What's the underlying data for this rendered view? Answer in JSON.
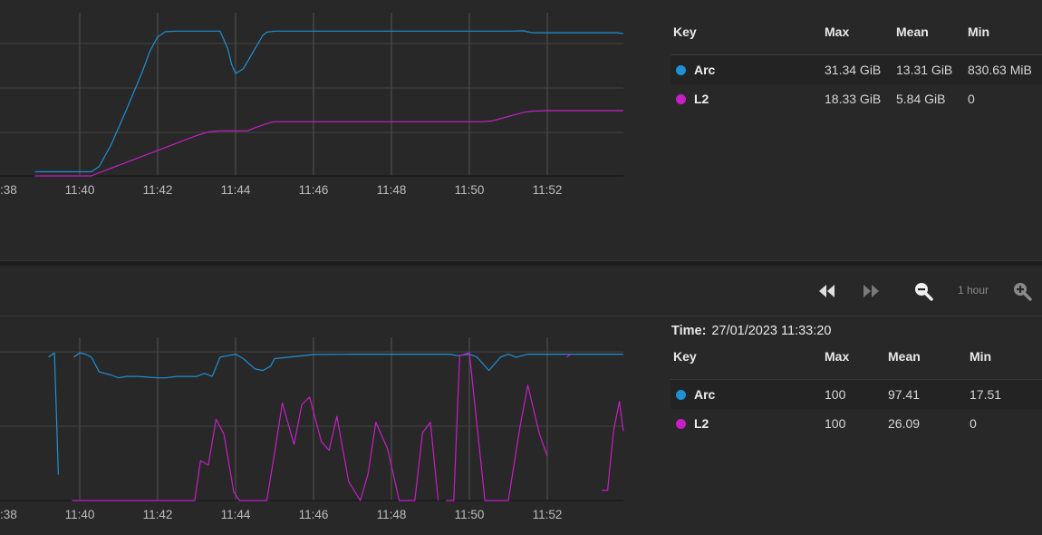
{
  "chart1": {
    "legend": {
      "headers": {
        "key": "Key",
        "max": "Max",
        "mean": "Mean",
        "min": "Min"
      },
      "rows": [
        {
          "name": "Arc",
          "max": "31.34 GiB",
          "mean": "13.31 GiB",
          "min": "830.63 MiB",
          "color": "#1e90d6"
        },
        {
          "name": "L2",
          "max": "18.33 GiB",
          "mean": "5.84 GiB",
          "min": "0",
          "color": "#c71ec7"
        }
      ]
    }
  },
  "chart2": {
    "time_label": "Time:",
    "time_value": "27/01/2023 11:33:20",
    "legend": {
      "headers": {
        "key": "Key",
        "max": "Max",
        "mean": "Mean",
        "min": "Min"
      },
      "rows": [
        {
          "name": "Arc",
          "max": "100",
          "mean": "97.41",
          "min": "17.51",
          "color": "#1e90d6"
        },
        {
          "name": "L2",
          "max": "100",
          "mean": "26.09",
          "min": "0",
          "color": "#c71ec7"
        }
      ]
    }
  },
  "toolbar": {
    "rewind_icon": "rewind-icon",
    "forward_icon": "fast-forward-icon",
    "zoom_out_icon": "zoom-out-icon",
    "zoom_in_icon": "zoom-in-icon",
    "range_label": "1 hour"
  },
  "chart_data": [
    {
      "type": "line",
      "x_ticks": [
        ":38",
        "11:40",
        "11:42",
        "11:44",
        "11:46",
        "11:48",
        "11:50",
        "11:52"
      ],
      "series": [
        {
          "name": "Arc",
          "color": "#1e90d6",
          "x": [
            38.85,
            39.0,
            39.5,
            40.0,
            40.3,
            40.5,
            40.8,
            41.2,
            41.6,
            41.8,
            42.0,
            42.2,
            42.5,
            43.0,
            43.4,
            43.6,
            43.8,
            43.9,
            44.0,
            44.2,
            44.5,
            44.7,
            44.8,
            45.0,
            46.0,
            47.0,
            48.0,
            49.0,
            50.0,
            51.0,
            51.4,
            51.6,
            52.0,
            53.0,
            53.8,
            53.95
          ],
          "y": [
            0.77,
            0.78,
            0.78,
            0.78,
            0.79,
            1.8,
            5.8,
            12.5,
            19.5,
            23.5,
            26.2,
            27.2,
            27.3,
            27.3,
            27.3,
            27.3,
            24.0,
            21.0,
            19.3,
            20.2,
            24.0,
            26.5,
            27.1,
            27.3,
            27.3,
            27.3,
            27.3,
            27.3,
            27.3,
            27.3,
            27.35,
            27.0,
            27.0,
            27.0,
            27.0,
            26.8
          ]
        },
        {
          "name": "L2",
          "color": "#c71ec7",
          "x": [
            38.85,
            39.5,
            40.0,
            40.3,
            40.5,
            41.0,
            41.5,
            42.0,
            42.5,
            43.0,
            43.3,
            43.6,
            44.0,
            44.3,
            44.5,
            44.9,
            45.0,
            46.0,
            47.0,
            48.0,
            49.0,
            50.0,
            50.3,
            50.6,
            51.0,
            51.4,
            51.6,
            52.0,
            53.0,
            53.95
          ],
          "y": [
            0.0,
            0.0,
            0.0,
            0.0,
            0.6,
            2.0,
            3.4,
            4.8,
            6.2,
            7.6,
            8.3,
            8.5,
            8.5,
            8.5,
            9.1,
            10.1,
            10.2,
            10.2,
            10.2,
            10.2,
            10.2,
            10.2,
            10.2,
            10.4,
            11.2,
            12.0,
            12.2,
            12.3,
            12.3,
            12.3
          ]
        }
      ]
    },
    {
      "type": "line",
      "x_ticks": [
        ":38",
        "11:40",
        "11:42",
        "11:44",
        "11:46",
        "11:48",
        "11:50",
        "11:52"
      ],
      "ylim": [
        0,
        100
      ],
      "series": [
        {
          "name": "Arc",
          "color": "#1e90d6",
          "segments": [
            {
              "x": [
                39.2,
                39.35
              ],
              "y": [
                97,
                100
              ]
            },
            {
              "x": [
                39.35,
                39.45
              ],
              "y": [
                100,
                17.5
              ]
            },
            {
              "x": [
                39.85,
                40.0,
                40.15,
                40.3,
                40.5,
                40.8,
                41.0,
                41.2,
                41.5,
                42.0,
                42.2,
                42.5,
                43.0,
                43.2,
                43.4,
                43.6,
                43.8,
                44.0,
                44.2,
                44.5,
                44.7,
                44.9,
                45.0,
                46.0,
                47.0,
                48.0,
                49.0,
                49.5,
                49.7,
                50.0,
                50.2,
                50.5,
                50.8,
                51.0,
                51.2,
                51.5,
                52.0,
                53.0,
                53.95
              ],
              "y": [
                97,
                100,
                99,
                97,
                87,
                85,
                83,
                84,
                84,
                83,
                83,
                84,
                84,
                86,
                84,
                97,
                98,
                99,
                96,
                89,
                88,
                91,
                96,
                98.8,
                99,
                99,
                99,
                99,
                98,
                99,
                97,
                88,
                97,
                99,
                97,
                99,
                99,
                99,
                99
              ]
            }
          ]
        },
        {
          "name": "L2",
          "color": "#c71ec7",
          "segments": [
            {
              "x": [
                39.8,
                40.5,
                41.5,
                42.5,
                42.95,
                43.1,
                43.3,
                43.5,
                43.7,
                43.95,
                44.1,
                44.4,
                44.8,
                45.0,
                45.2,
                45.5,
                45.7,
                45.9,
                46.2,
                46.4,
                46.6,
                46.9,
                47.2,
                47.4,
                47.6,
                47.9,
                48.2,
                48.4,
                48.6,
                48.8,
                49.0,
                49.2
              ],
              "y": [
                0,
                0,
                0,
                0,
                0,
                27,
                24,
                55,
                45,
                6,
                0,
                0,
                0,
                32,
                66,
                38,
                65,
                70,
                40,
                34,
                57,
                13,
                0,
                18,
                53,
                35,
                0,
                0,
                0,
                46,
                53,
                0
              ]
            },
            {
              "x": [
                49.4,
                49.6,
                49.75,
                50.0,
                50.2,
                50.4,
                50.6,
                50.8,
                51.0,
                51.3,
                51.5,
                51.8,
                52.0
              ],
              "y": [
                0,
                0,
                98,
                100,
                50,
                0,
                0,
                0,
                0,
                50,
                78,
                45,
                30
              ]
            },
            {
              "x": [
                52.5,
                52.6
              ],
              "y": [
                97,
                99
              ]
            },
            {
              "x": [
                53.4,
                53.55,
                53.7,
                53.85,
                53.95
              ],
              "y": [
                7,
                7,
                47,
                67,
                47
              ]
            }
          ]
        }
      ]
    }
  ]
}
